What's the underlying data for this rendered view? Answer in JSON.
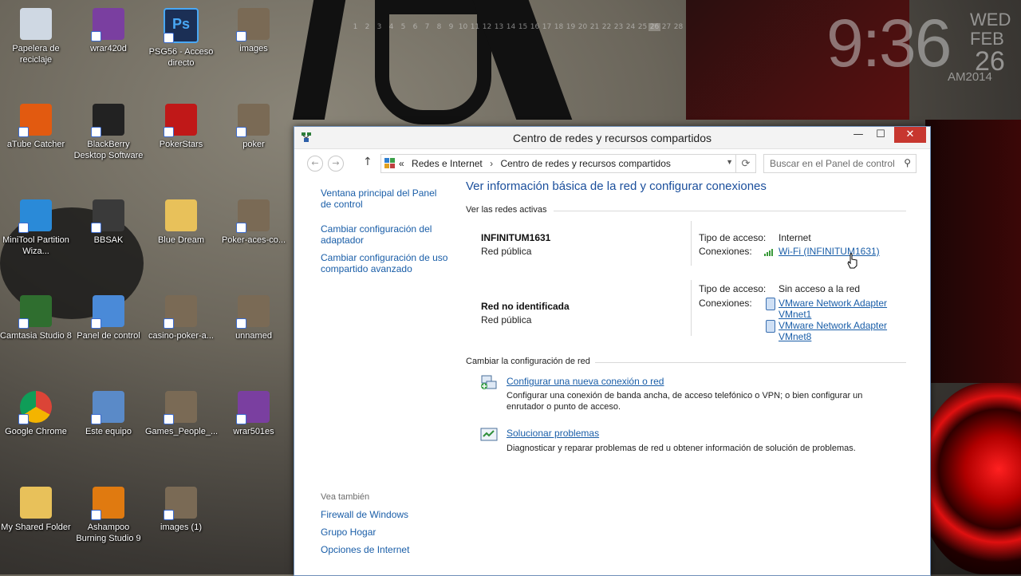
{
  "desktop": {
    "clock": {
      "time": "9:36",
      "weekday": "WED",
      "month": "FEB",
      "day": "26",
      "ampm_year": "AM2014"
    },
    "calendar_strip": [
      "1",
      "2",
      "3",
      "4",
      "5",
      "6",
      "7",
      "8",
      "9",
      "10",
      "11",
      "12",
      "13",
      "14",
      "15",
      "16",
      "17",
      "18",
      "19",
      "20",
      "21",
      "22",
      "23",
      "24",
      "25",
      "26",
      "27",
      "28"
    ],
    "calendar_today": "26",
    "icons": [
      {
        "label": "Papelera de reciclaje",
        "icon": "recycle-bin-icon"
      },
      {
        "label": "wrar420d",
        "icon": "winrar-icon"
      },
      {
        "label": "PSG56 - Acceso directo",
        "icon": "photoshop-icon"
      },
      {
        "label": "images",
        "icon": "image-icon"
      },
      {
        "label": "aTube Catcher",
        "icon": "atube-icon"
      },
      {
        "label": "BlackBerry Desktop Software",
        "icon": "blackberry-icon"
      },
      {
        "label": "PokerStars",
        "icon": "pokerstars-icon"
      },
      {
        "label": "poker",
        "icon": "image-icon"
      },
      {
        "label": "MiniTool Partition Wiza...",
        "icon": "minitool-icon"
      },
      {
        "label": "BBSAK",
        "icon": "bbsak-icon"
      },
      {
        "label": "Blue Dream",
        "icon": "folder-icon"
      },
      {
        "label": "Poker-aces-co...",
        "icon": "image-icon"
      },
      {
        "label": "Camtasia Studio 8",
        "icon": "camtasia-icon"
      },
      {
        "label": "Panel de control",
        "icon": "control-panel-icon"
      },
      {
        "label": "casino-poker-a...",
        "icon": "image-icon"
      },
      {
        "label": "unnamed",
        "icon": "image-icon"
      },
      {
        "label": "Google Chrome",
        "icon": "chrome-icon"
      },
      {
        "label": "Este equipo",
        "icon": "computer-icon"
      },
      {
        "label": "Games_People_...",
        "icon": "image-icon"
      },
      {
        "label": "wrar501es",
        "icon": "winrar-icon"
      },
      {
        "label": "My Shared Folder",
        "icon": "folder-icon"
      },
      {
        "label": "Ashampoo Burning Studio 9",
        "icon": "ashampoo-icon"
      },
      {
        "label": "images (1)",
        "icon": "image-icon"
      }
    ]
  },
  "window": {
    "title": "Centro de redes y recursos compartidos",
    "controls": {
      "minimize": "—",
      "maximize": "☐",
      "close": "✕"
    },
    "address": {
      "prefix": "«",
      "crumbs": [
        "Redes e Internet",
        "Centro de redes y recursos compartidos"
      ],
      "separator": "›"
    },
    "search_placeholder": "Buscar en el Panel de control",
    "sidebar": {
      "links": [
        "Ventana principal del Panel de control",
        "Cambiar configuración del adaptador",
        "Cambiar configuración de uso compartido avanzado"
      ],
      "see_also_label": "Vea también",
      "see_also": [
        "Firewall de Windows",
        "Grupo Hogar",
        "Opciones de Internet"
      ]
    },
    "main": {
      "heading": "Ver información básica de la red y configurar conexiones",
      "active_networks_label": "Ver las redes activas",
      "networks": [
        {
          "name": "INFINITUM1631",
          "category": "Red pública",
          "access_label": "Tipo de acceso:",
          "access_value": "Internet",
          "connections_label": "Conexiones:",
          "connections": [
            "Wi-Fi (INFINITUM1631)"
          ]
        },
        {
          "name": "Red no identificada",
          "category": "Red pública",
          "access_label": "Tipo de acceso:",
          "access_value": "Sin acceso a la red",
          "connections_label": "Conexiones:",
          "connections": [
            "VMware Network Adapter VMnet1",
            "VMware Network Adapter VMnet8"
          ]
        }
      ],
      "change_settings_label": "Cambiar la configuración de red",
      "tasks": [
        {
          "title": "Configurar una nueva conexión o red",
          "description": "Configurar una conexión de banda ancha, de acceso telefónico o VPN; o bien configurar un enrutador o punto de acceso."
        },
        {
          "title": "Solucionar problemas",
          "description": "Diagnosticar y reparar problemas de red u obtener información de solución de problemas."
        }
      ]
    }
  },
  "colors": {
    "link": "#1a5ea8",
    "heading": "#1b4f9c",
    "close_button": "#c7372f"
  }
}
